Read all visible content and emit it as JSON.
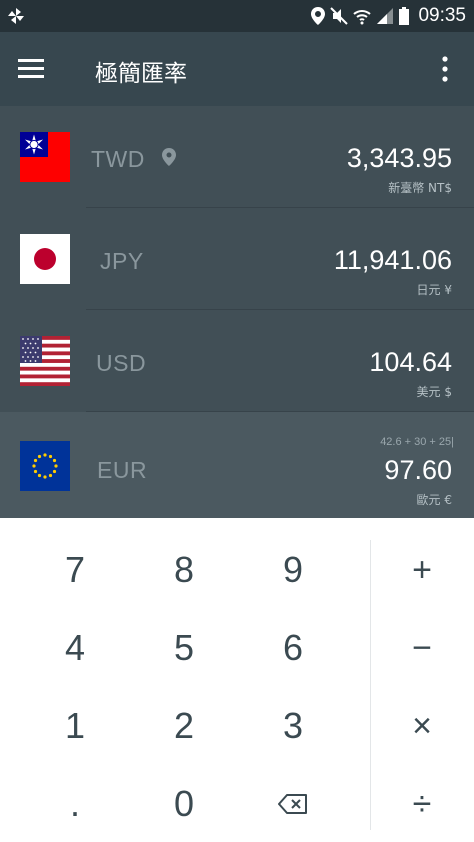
{
  "status_bar": {
    "time": "09:35",
    "icons": [
      "pinwheel-icon",
      "location-icon",
      "mute-icon",
      "wifi-icon",
      "signal-icon",
      "battery-icon"
    ]
  },
  "app_bar": {
    "title": "極簡匯率",
    "icons": [
      "menu-icon",
      "more-vert-icon"
    ]
  },
  "currencies": [
    {
      "code": "TWD",
      "name": "新臺幣 NT$",
      "amount": "3,343.95",
      "flag": "taiwan",
      "location_pin": true
    },
    {
      "code": "JPY",
      "name": "日元 ¥",
      "amount": "11,941.06",
      "flag": "japan"
    },
    {
      "code": "USD",
      "name": "美元 $",
      "amount": "104.64",
      "flag": "usa"
    },
    {
      "code": "EUR",
      "name": "歐元 €",
      "amount": "97.60",
      "flag": "eu",
      "active": true,
      "expression": "42.6 + 30 + 25|"
    }
  ],
  "keypad": {
    "keys": [
      "7",
      "8",
      "9",
      "+",
      "4",
      "5",
      "6",
      "−",
      "1",
      "2",
      "3",
      "×",
      ".",
      "0",
      "⌫",
      "÷"
    ]
  },
  "colors": {
    "status_bar": "#263238",
    "app_bar": "#37474f",
    "row": "#414f56",
    "row_active": "#4b5960",
    "keypad": "#ffffff",
    "key_text": "#3b4a51"
  }
}
